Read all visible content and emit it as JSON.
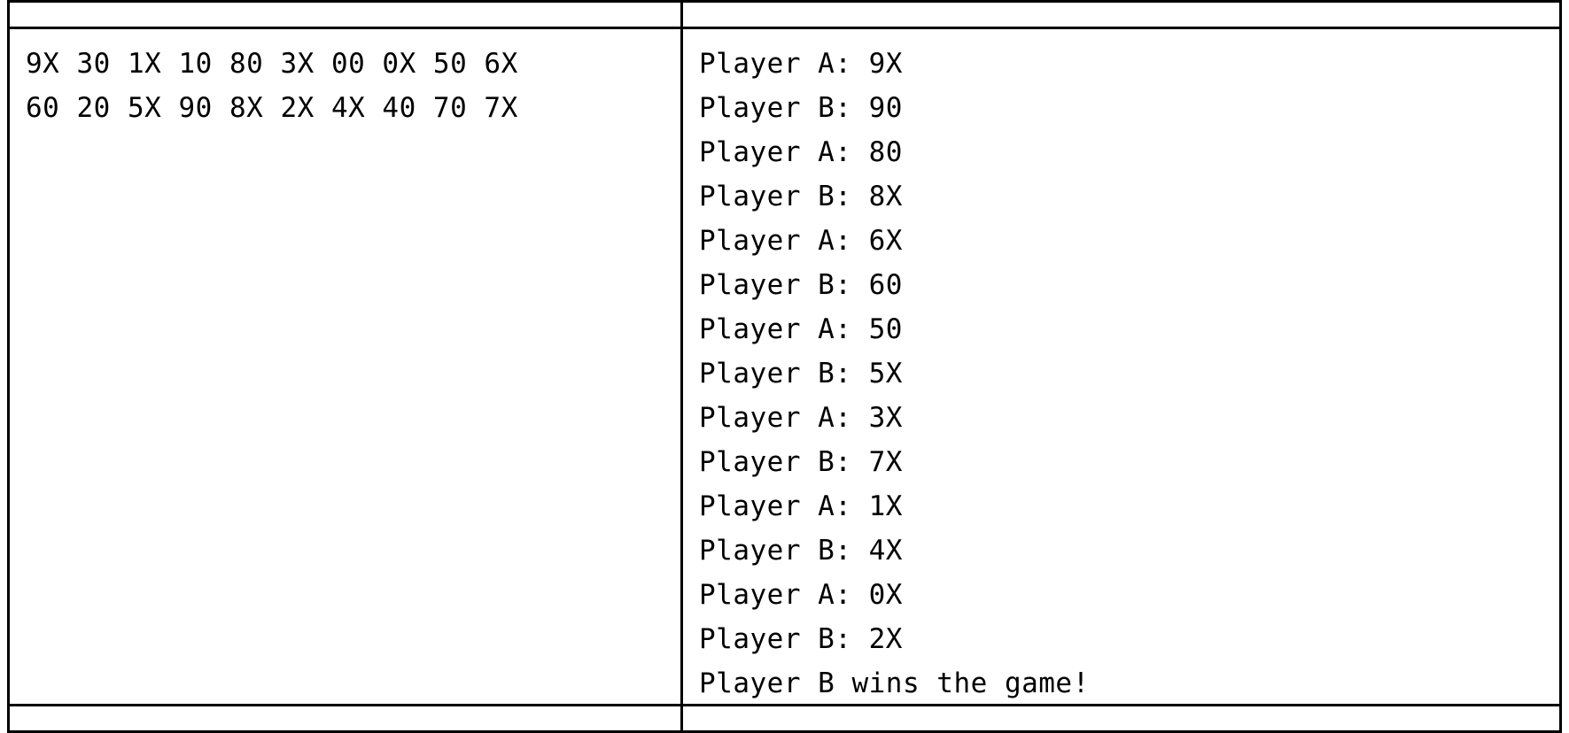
{
  "left": {
    "line1": "9X 30 1X 10 80 3X 00 0X 50 6X",
    "line2": "60 20 5X 90 8X 2X 4X 40 70 7X"
  },
  "right": {
    "lines": [
      "Player A: 9X",
      "Player B: 90",
      "Player A: 80",
      "Player B: 8X",
      "Player A: 6X",
      "Player B: 60",
      "Player A: 50",
      "Player B: 5X",
      "Player A: 3X",
      "Player B: 7X",
      "Player A: 1X",
      "Player B: 4X",
      "Player A: 0X",
      "Player B: 2X",
      "Player B wins the game!"
    ]
  }
}
